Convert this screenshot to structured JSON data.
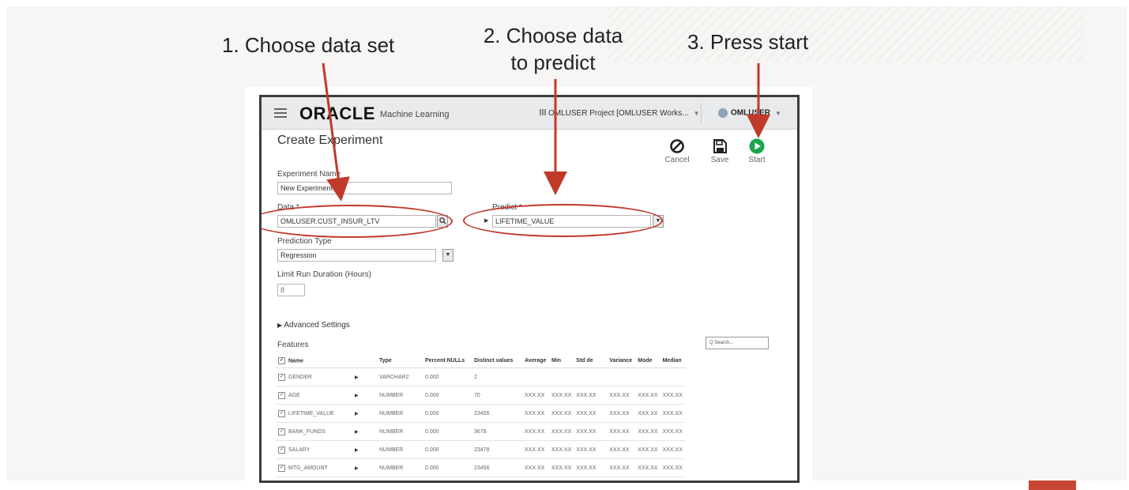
{
  "annotations": {
    "step1": "1. Choose data set",
    "step2_line1": "2. Choose data",
    "step2_line2": "to predict",
    "step3": "3. Press start"
  },
  "colors": {
    "accent": "#c0392b",
    "brand_red": "#c74634",
    "start_green": "#1aa64b"
  },
  "app": {
    "logo": "ORACLE",
    "subtitle": "Machine Learning",
    "project": "OMLUSER Project [OMLUSER Works...",
    "user": "OMLUSER"
  },
  "page": {
    "title": "Create Experiment",
    "actions": {
      "cancel": "Cancel",
      "save": "Save",
      "start": "Start"
    }
  },
  "form": {
    "experiment_name_label": "Experiment Name",
    "experiment_name_value": "New Experiment",
    "data_label": "Data *",
    "data_value": "OMLUSER.CUST_INSUR_LTV",
    "predict_label": "Predict *",
    "predict_value": "LIFETIME_VALUE",
    "prediction_type_label": "Prediction Type",
    "prediction_type_value": "Regression",
    "limit_label": "Limit Run Duration (Hours)",
    "limit_value": "8",
    "advanced": "Advanced Settings"
  },
  "features": {
    "label": "Features",
    "search_placeholder": "Q Search...",
    "columns": [
      "Name",
      "Type",
      "Percent NULLs",
      "Distinct values",
      "Average",
      "Min",
      "Std de",
      "Variance",
      "Mode",
      "Median"
    ],
    "rows": [
      [
        "GENDER",
        "VARCHAR2",
        "0.000",
        "2",
        "",
        "",
        "",
        "",
        "",
        ""
      ],
      [
        "AGE",
        "NUMBER",
        "0.000",
        "70",
        "XXX.XX",
        "XXX.XX",
        "XXX.XX",
        "XXX.XX",
        "XXX.XX",
        "XXX.XX"
      ],
      [
        "LIFETIME_VALUE",
        "NUMBER",
        "0.000",
        "23456",
        "XXX.XX",
        "XXX.XX",
        "XXX.XX",
        "XXX.XX",
        "XXX.XX",
        "XXX.XX"
      ],
      [
        "BANK_FUNDS",
        "NUMBER",
        "0.000",
        "3678",
        "XXX.XX",
        "XXX.XX",
        "XXX.XX",
        "XXX.XX",
        "XXX.XX",
        "XXX.XX"
      ],
      [
        "SALARY",
        "NUMBER",
        "0.000",
        "23478",
        "XXX.XX",
        "XXX.XX",
        "XXX.XX",
        "XXX.XX",
        "XXX.XX",
        "XXX.XX"
      ],
      [
        "MTG_AMOUNT",
        "NUMBER",
        "0.000",
        "23456",
        "XXX.XX",
        "XXX.XX",
        "XXX.XX",
        "XXX.XX",
        "XXX.XX",
        "XXX.XX"
      ]
    ]
  }
}
